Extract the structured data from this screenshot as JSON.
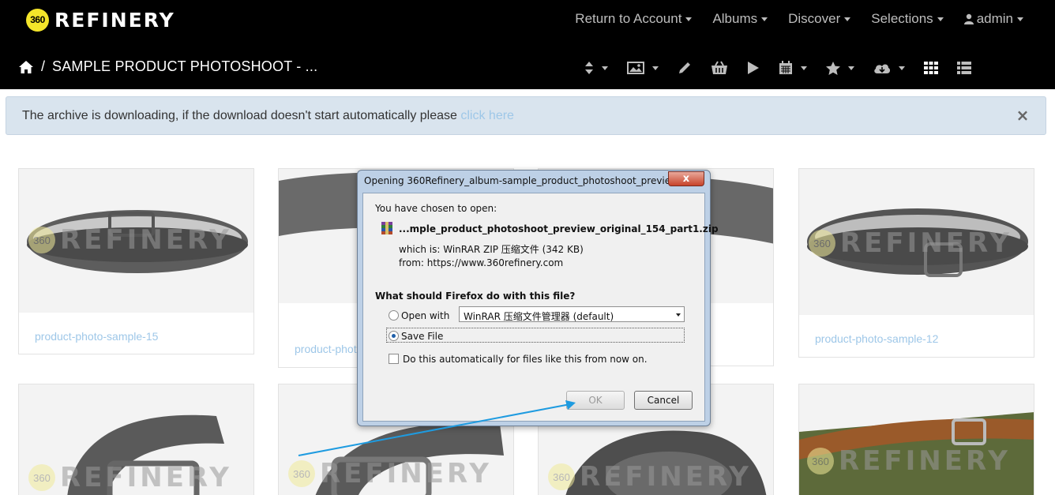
{
  "brand": {
    "logo_text": "360",
    "name": "REFINERY"
  },
  "topnav": {
    "items": [
      {
        "label": "Return to Account"
      },
      {
        "label": "Albums"
      },
      {
        "label": "Discover"
      },
      {
        "label": "Selections"
      }
    ],
    "user_label": "admin"
  },
  "breadcrumb": {
    "separator": "/",
    "title": "SAMPLE PRODUCT PHOTOSHOOT - ..."
  },
  "toolbar": {
    "icons": [
      "sort-icon",
      "image-icon",
      "pencil-icon",
      "basket-icon",
      "play-icon",
      "calendar-icon",
      "star-icon",
      "cloud-download-icon",
      "grid-view-icon",
      "list-view-icon"
    ]
  },
  "alert": {
    "text": "The archive is downloading, if the download doesn't start automatically please ",
    "link": "click here",
    "close": "×"
  },
  "gallery": {
    "watermark_logo": "360",
    "watermark_text": "REFINERY",
    "captions": [
      "product-photo-sample-15",
      "product-phot",
      "product-photo-sample-12"
    ]
  },
  "dialog": {
    "title": "Opening 360Refinery_album-sample_product_photoshoot_previe...",
    "close": "x",
    "chosen": "You have chosen to open:",
    "filename": "...mple_product_photoshoot_preview_original_154_part1.zip",
    "which_is": "which is:  WinRAR ZIP 压缩文件 (342 KB)",
    "from": "from:  https://www.360refinery.com",
    "question": "What should Firefox do with this file?",
    "open_with_label": "Open with",
    "open_with_value": "WinRAR 压缩文件管理器 (default)",
    "save_file_label": "Save File",
    "auto_label": "Do this automatically for files like this from now on.",
    "ok": "OK",
    "cancel": "Cancel",
    "selected_action": "Save File",
    "auto_checked": false
  },
  "colors": {
    "accent_link": "#9ec7e8",
    "alert_bg": "#d9e4ee",
    "arrow": "#1e9be0",
    "navbar": "#000000"
  }
}
